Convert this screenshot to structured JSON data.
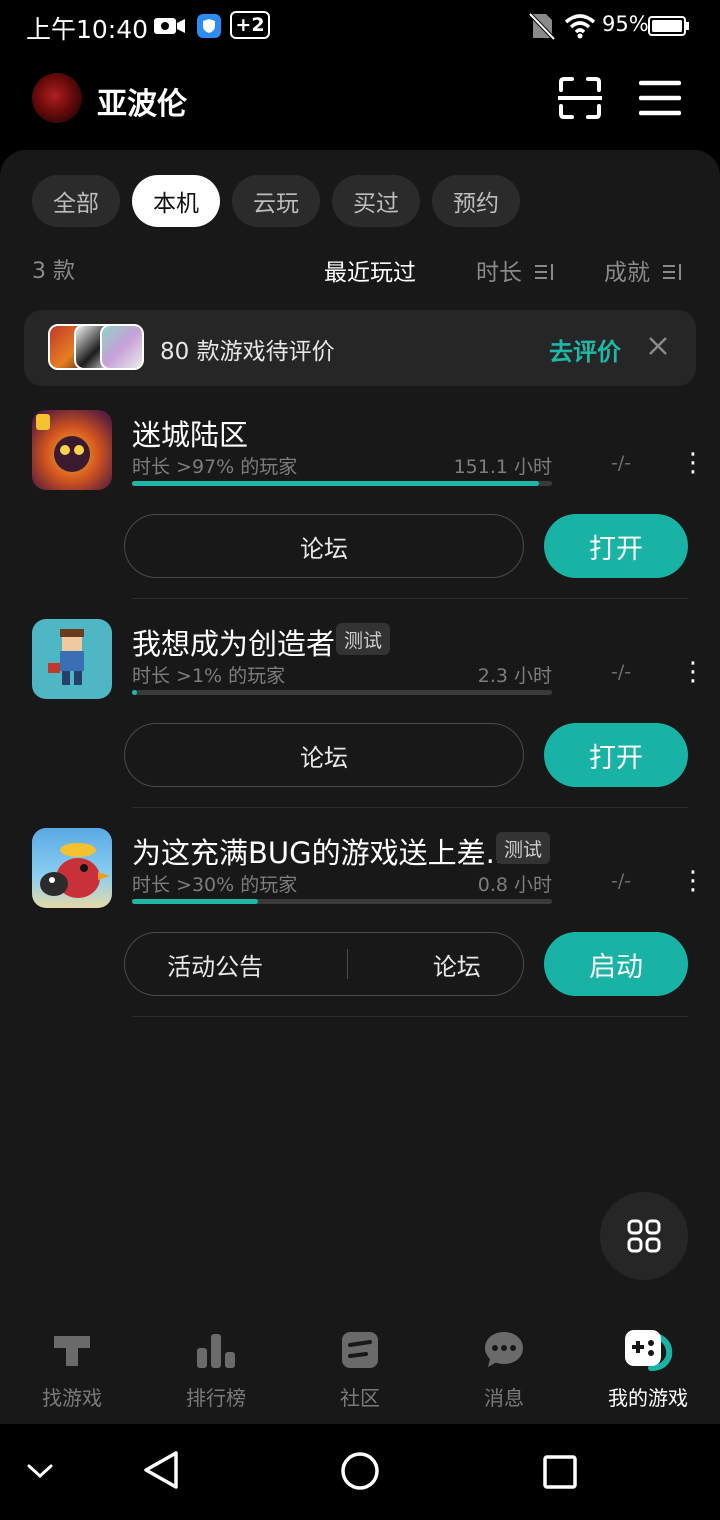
{
  "status_bar": {
    "time": "上午10:40",
    "notification_count": "+2",
    "battery": "95%"
  },
  "header": {
    "user_name": "亚波伦"
  },
  "filter_tabs": [
    {
      "label": "全部",
      "active": false
    },
    {
      "label": "本机",
      "active": true
    },
    {
      "label": "云玩",
      "active": false
    },
    {
      "label": "买过",
      "active": false
    },
    {
      "label": "预约",
      "active": false
    }
  ],
  "list_info": {
    "count": "3 款",
    "sort_options": [
      {
        "label": "最近玩过",
        "active": true
      },
      {
        "label": "时长",
        "active": false
      },
      {
        "label": "成就",
        "active": false
      }
    ]
  },
  "review_banner": {
    "text": "80 款游戏待评价",
    "action": "去评价"
  },
  "games": [
    {
      "title": "迷城陆区",
      "tag": "",
      "stat": "时长 >97% 的玩家",
      "hours": "151.1 小时",
      "rating": "-/-",
      "progress": 0.97,
      "buttons": [
        "论坛"
      ],
      "primary": "打开"
    },
    {
      "title": "我想成为创造者",
      "tag": "测试",
      "stat": "时长 >1% 的玩家",
      "hours": "2.3 小时",
      "rating": "-/-",
      "progress": 0.01,
      "buttons": [
        "论坛"
      ],
      "primary": "打开"
    },
    {
      "title": "为这充满BUG的游戏送上差...",
      "tag": "测试",
      "stat": "时长 >30% 的玩家",
      "hours": "0.8 小时",
      "rating": "-/-",
      "progress": 0.3,
      "buttons": [
        "活动公告",
        "论坛"
      ],
      "primary": "启动"
    }
  ],
  "bottom_nav": [
    {
      "label": "找游戏",
      "icon": "find-games-icon",
      "active": false
    },
    {
      "label": "排行榜",
      "icon": "ranking-icon",
      "active": false
    },
    {
      "label": "社区",
      "icon": "community-icon",
      "active": false
    },
    {
      "label": "消息",
      "icon": "message-icon",
      "active": false
    },
    {
      "label": "我的游戏",
      "icon": "my-games-icon",
      "active": true
    }
  ],
  "colors": {
    "accent": "#18b3a4",
    "background": "#181818",
    "surface": "#262626"
  }
}
